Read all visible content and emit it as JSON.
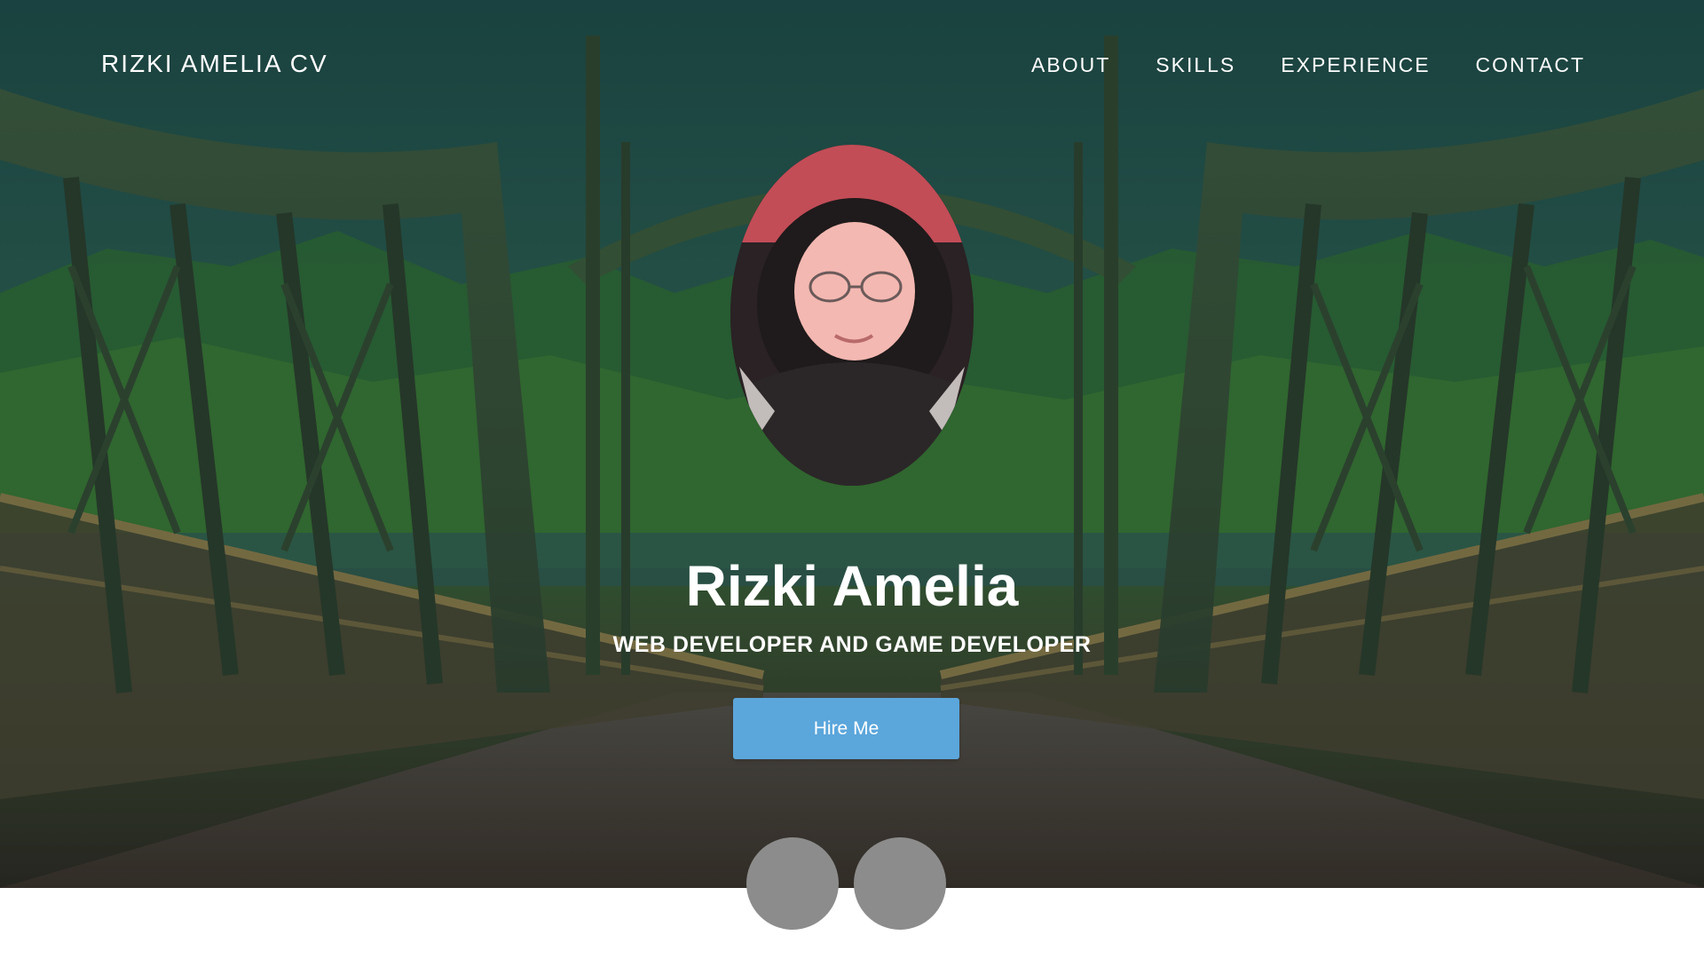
{
  "header": {
    "brand": "RIZKI AMELIA CV",
    "nav": [
      "ABOUT",
      "SKILLS",
      "EXPERIENCE",
      "CONTACT"
    ]
  },
  "hero": {
    "name": "Rizki Amelia",
    "subtitle": "WEB DEVELOPER AND GAME DEVELOPER",
    "cta_label": "Hire Me",
    "background": "bridge-landscape-photo",
    "avatar": "profile-photo"
  },
  "social": {
    "icons": [
      "social-icon",
      "social-icon"
    ]
  },
  "colors": {
    "button": "#5ba6db",
    "social_circle": "#8c8c8c",
    "text": "#ffffff",
    "page_background": "#ffffff"
  }
}
